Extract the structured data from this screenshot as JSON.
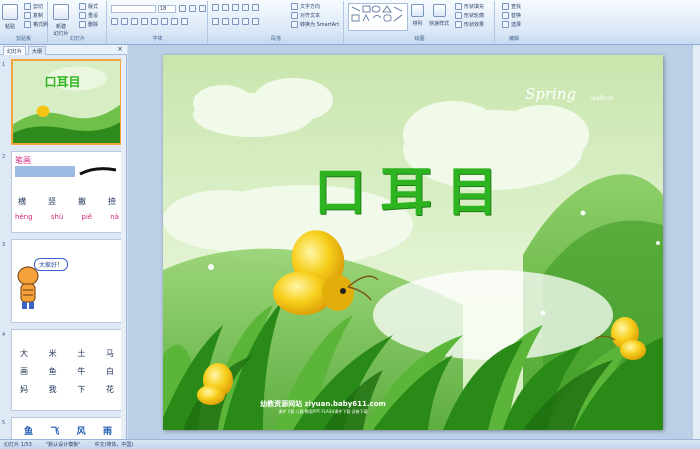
{
  "ribbon": {
    "groups": {
      "clipboard": "剪贴板",
      "slides": "幻灯片",
      "font": "字体",
      "paragraph": "段落",
      "drawing": "绘图",
      "editing": "编辑"
    },
    "paste": "粘贴",
    "cut": "剪切",
    "copy": "复制",
    "format_painter": "格式刷",
    "new_slide": "新建\n幻灯片",
    "layout": "版式",
    "reset": "重设",
    "delete": "删除",
    "font_size": "18",
    "text_direction": "文字方向",
    "align_text": "对齐文本",
    "smartart": "转换为 SmartArt",
    "arrange": "排列",
    "quick_styles": "快速样式",
    "shape_fill": "形状填充",
    "shape_outline": "形状轮廓",
    "shape_effects": "形状效果",
    "find": "查找",
    "replace": "替换",
    "select": "选择"
  },
  "panel": {
    "tabs": [
      "幻灯片",
      "大纲"
    ],
    "slide_numbers": [
      "1",
      "2",
      "3",
      "4",
      "5"
    ],
    "thumb1_title": "口耳目",
    "thumb2": {
      "title": "笔画",
      "chars": [
        "横",
        "竖",
        "撇",
        "捺"
      ],
      "pinyin": [
        "héng",
        "shù",
        "piě",
        "nà"
      ]
    },
    "thumb3_bubble": "大家好！",
    "thumb4_rows": [
      [
        "大",
        "米",
        "土",
        "马"
      ],
      [
        "画",
        "鱼",
        "牛",
        "白"
      ],
      [
        "妈",
        "我",
        "下",
        "花"
      ]
    ],
    "thumb5_chars": [
      "鱼",
      "飞",
      "风",
      "雨"
    ]
  },
  "slide": {
    "title": "口耳目",
    "watermark": "Spring",
    "watermark_small": "wallcoo",
    "site_line": "幼教资源网站 ziyuan.baby611.com",
    "site_subline": "课件下载 儿歌 教案PPT FLASH课件下载 试卷下载"
  },
  "status": {
    "slide_counter": "幻灯片 1/53",
    "theme": "\"默认设计模板\"",
    "language": "中文(简体，中国)"
  },
  "colors": {
    "title_green": "#2fb421",
    "sky": "#d9efc5",
    "grass": "#2f8a1c",
    "accent": "#f3a53b"
  }
}
